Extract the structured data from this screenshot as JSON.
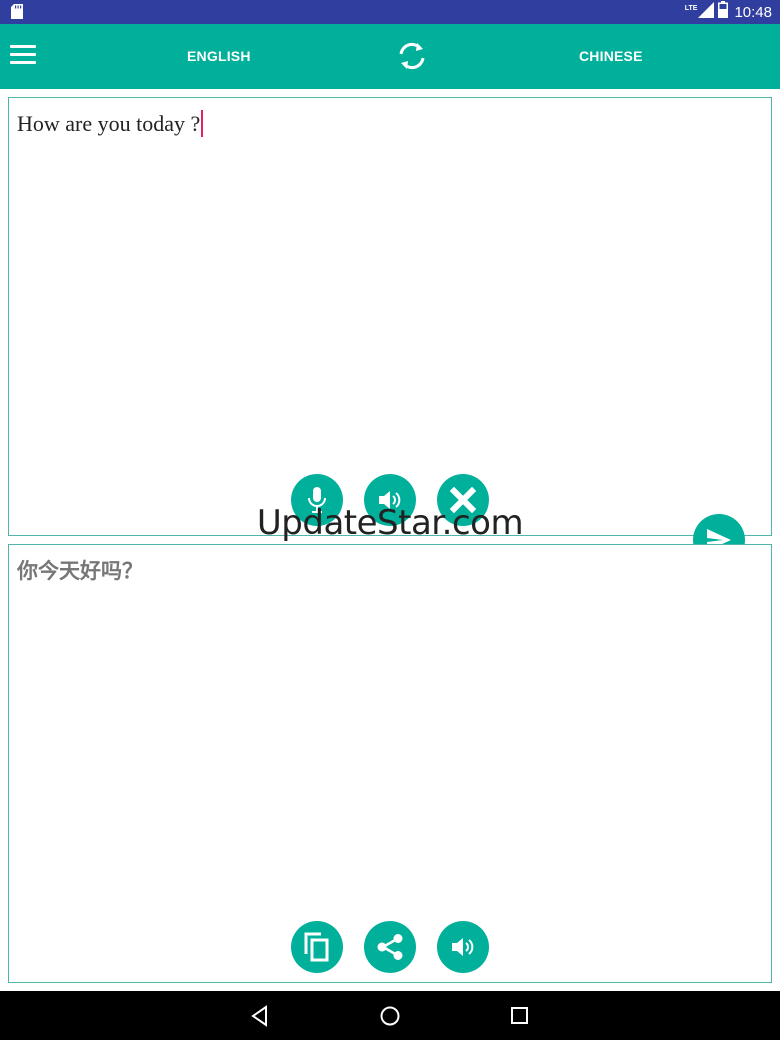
{
  "status_bar": {
    "network": "LTE",
    "time": "10:48",
    "icons": [
      "sd-card-icon",
      "signal-icon",
      "battery-icon"
    ]
  },
  "toolbar": {
    "source_language": "ENGLISH",
    "target_language": "CHINESE",
    "icons": [
      "menu-icon",
      "swap-languages-icon"
    ]
  },
  "source_panel": {
    "text": "How are you today ?",
    "actions": [
      "microphone-icon",
      "speaker-icon",
      "clear-icon"
    ]
  },
  "target_panel": {
    "text": "你今天好吗？",
    "actions": [
      "copy-icon",
      "share-icon",
      "speaker-icon"
    ]
  },
  "translate_button": "send-icon",
  "watermark": "UpdateStar.com",
  "nav_bar": [
    "back-icon",
    "home-icon",
    "recents-icon"
  ],
  "colors": {
    "primary": "#00b09b",
    "status_bar": "#303f9f",
    "caret": "#e91e63"
  }
}
